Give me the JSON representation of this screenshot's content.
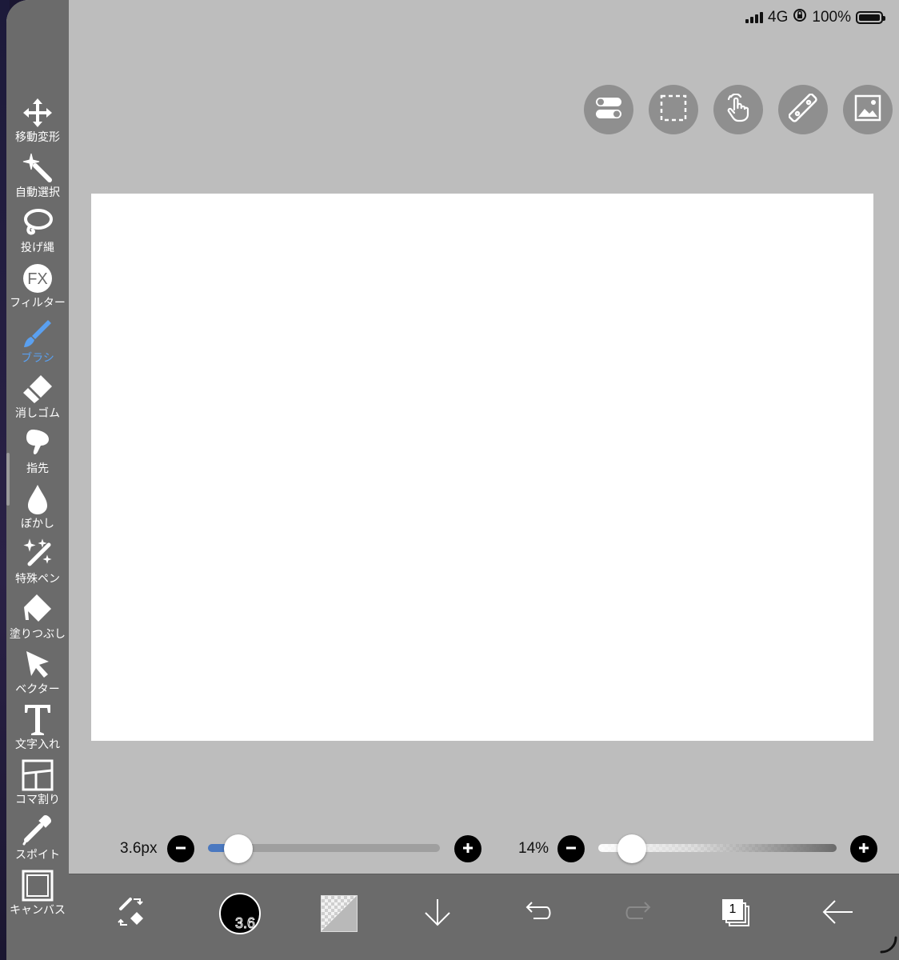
{
  "status_bar": {
    "network": "4G",
    "battery": "100%"
  },
  "tools": [
    {
      "label": "移動変形",
      "icon": "move-arrows-icon",
      "active": false
    },
    {
      "label": "自動選択",
      "icon": "magic-wand-icon",
      "active": false
    },
    {
      "label": "投げ縄",
      "icon": "lasso-icon",
      "active": false
    },
    {
      "label": "フィルター",
      "icon": "fx-filter-icon",
      "active": false
    },
    {
      "label": "ブラシ",
      "icon": "brush-icon",
      "active": true
    },
    {
      "label": "消しゴム",
      "icon": "eraser-icon",
      "active": false
    },
    {
      "label": "指先",
      "icon": "finger-smudge-icon",
      "active": false
    },
    {
      "label": "ぼかし",
      "icon": "blur-drop-icon",
      "active": false
    },
    {
      "label": "特殊ペン",
      "icon": "special-pen-icon",
      "active": false
    },
    {
      "label": "塗りつぶし",
      "icon": "fill-bucket-icon",
      "active": false
    },
    {
      "label": "ベクター",
      "icon": "vector-cursor-icon",
      "active": false
    },
    {
      "label": "文字入れ",
      "icon": "text-t-icon",
      "active": false
    },
    {
      "label": "コマ割り",
      "icon": "panel-split-icon",
      "active": false
    },
    {
      "label": "スポイト",
      "icon": "eyedropper-icon",
      "active": false
    },
    {
      "label": "キャンバス",
      "icon": "canvas-square-icon",
      "active": false
    }
  ],
  "fx_text": "FX",
  "top_buttons": [
    "toggle-settings-icon",
    "selection-icon",
    "touch-gesture-icon",
    "ruler-icon",
    "material-image-icon"
  ],
  "brush_size": {
    "value_text": "3.6px",
    "level": 0.13
  },
  "opacity": {
    "value_text": "14%",
    "level": 0.14
  },
  "bottom_bar": {
    "color_size_text": "3.6",
    "layer_count": "1",
    "accent_color": "#5aa0f0"
  }
}
